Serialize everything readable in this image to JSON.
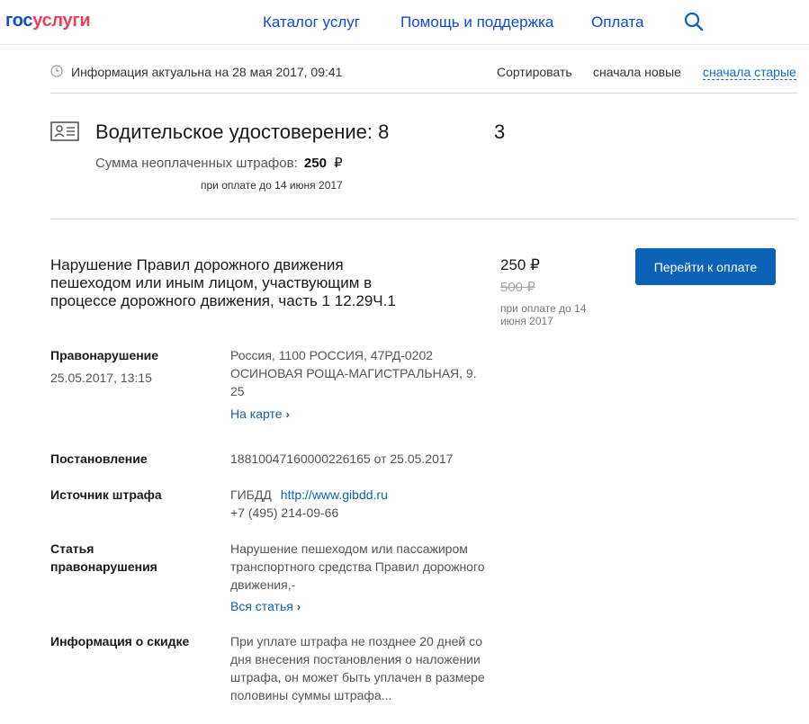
{
  "header": {
    "logo_part1": "гос",
    "logo_part2": "услуги",
    "nav": {
      "catalog": "Каталог услуг",
      "help": "Помощь и поддержка",
      "payment": "Оплата"
    },
    "search_icon": "search-icon"
  },
  "infobar": {
    "actual_text": "Информация актуальна на 28 мая 2017, 09:41",
    "sort_label": "Сортировать",
    "sort_new": "сначала новые",
    "sort_old": "сначала старые"
  },
  "license": {
    "title": "Водительское удостоверение: 8",
    "title_tail": "3",
    "unpaid_label": "Сумма неоплаченных штрафов:",
    "unpaid_amount": "250",
    "currency": "₽",
    "until": "при оплате до 14 июня 2017"
  },
  "fine": {
    "title": "Нарушение Правил дорожного движения пешеходом или иным лицом, участвующим в процессе дорожного движения, часть 1 12.29Ч.1",
    "amount": "250 ₽",
    "old_amount": "500 ₽",
    "until": "при оплате до 14 июня 2017",
    "pay_button": "Перейти к оплате"
  },
  "details": {
    "offense_label": "Правонарушение",
    "offense_datetime": "25.05.2017, 13:15",
    "offense_place": "Россия, 1100 РОССИЯ, 47РД-0202 ОСИНОВАЯ РОЩА-МАГИСТРАЛЬНАЯ, 9. 25",
    "map_link": "На карте",
    "decision_label": "Постановление",
    "decision_value": "18810047160000226165 от 25.05.2017",
    "source_label": "Источник штрафа",
    "source_name": "ГИБДД",
    "source_site": "http://www.gibdd.ru",
    "source_phone": "+7 (495) 214-09-66",
    "article_label_1": "Статья",
    "article_label_2": "правонарушения",
    "article_value": "Нарушение пешеходом или пассажиром транспортного средства Правил дорожного движения,-",
    "article_link": "Вся статья",
    "discount_label": "Информация о скидке",
    "discount_value": "При уплате штрафа не позднее 20 дней со дня внесения постановления о наложении штрафа, он может быть уплачен в размере половины суммы штрафа..."
  }
}
